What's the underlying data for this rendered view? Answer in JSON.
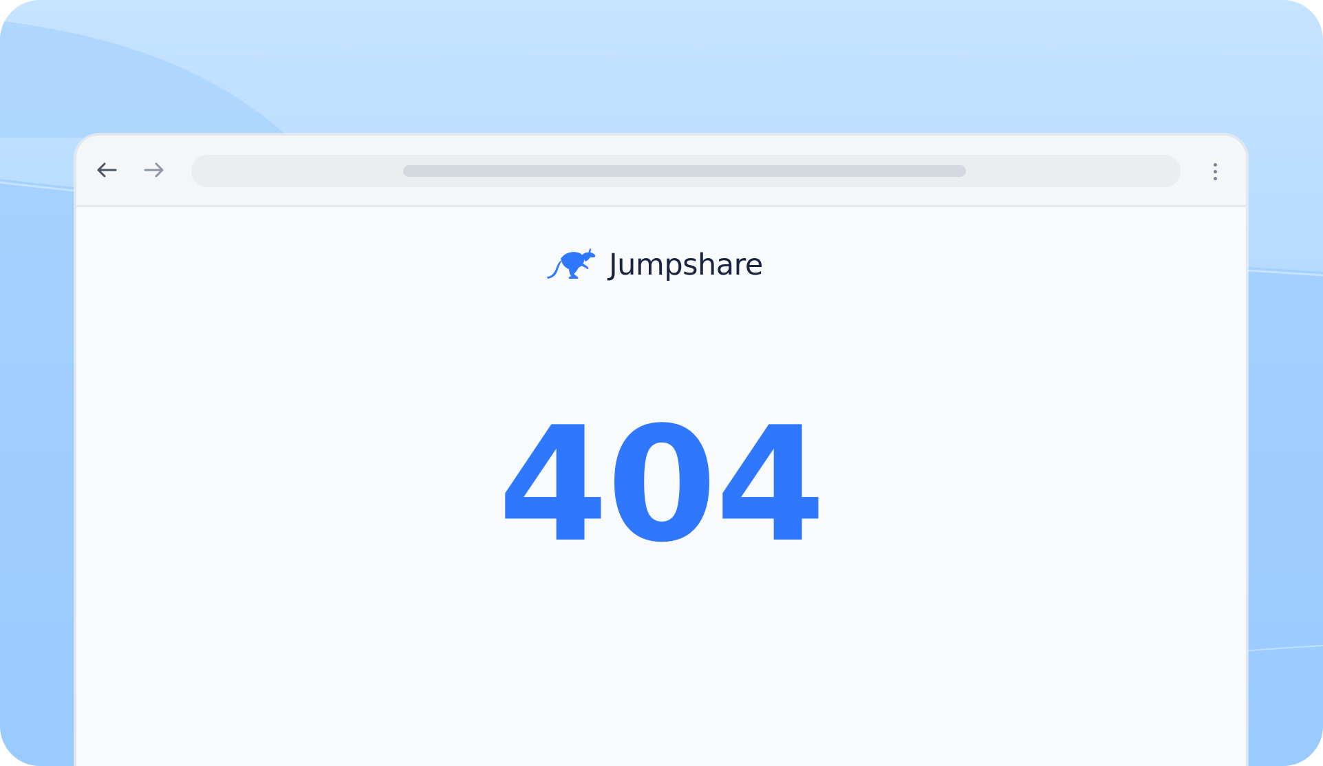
{
  "browser": {
    "back_icon": "arrow-left-icon",
    "forward_icon": "arrow-right-icon",
    "menu_icon": "kebab-menu-icon",
    "address_bar": {
      "value": ""
    }
  },
  "page": {
    "logo": {
      "icon": "kangaroo-icon",
      "text": "Jumpshare"
    },
    "error_code": "404"
  },
  "colors": {
    "brand_blue": "#2f78fe",
    "logo_text": "#1a2440",
    "background_blue": "#b4daff",
    "page_bg": "#f9fafb"
  }
}
